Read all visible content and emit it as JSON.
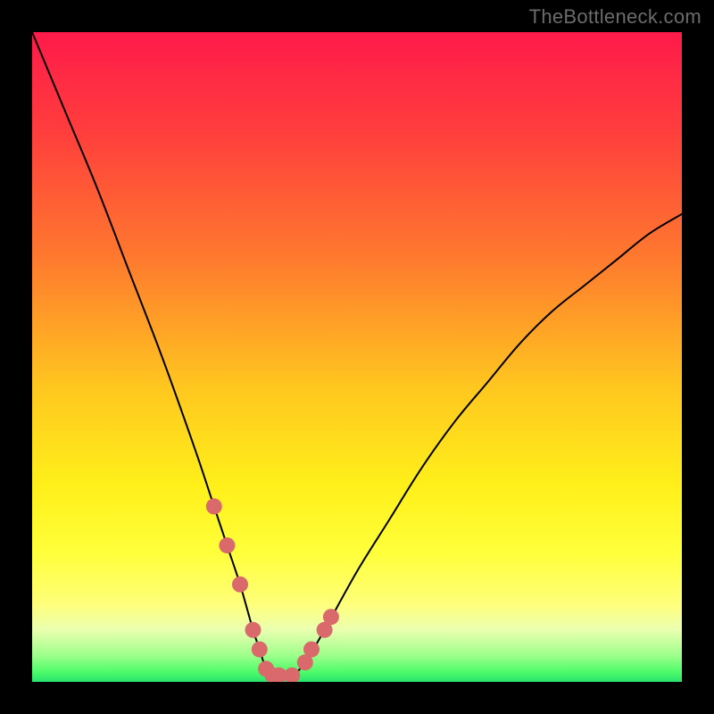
{
  "watermark": "TheBottleneck.com",
  "chart_data": {
    "type": "line",
    "title": "",
    "xlabel": "",
    "ylabel": "",
    "xlim": [
      0,
      100
    ],
    "ylim": [
      0,
      100
    ],
    "series": [
      {
        "name": "bottleneck-curve",
        "x": [
          0,
          5,
          10,
          15,
          20,
          25,
          28,
          30,
          32,
          34,
          35,
          36,
          37,
          38,
          40,
          42,
          45,
          50,
          55,
          60,
          65,
          70,
          75,
          80,
          85,
          90,
          95,
          100
        ],
        "values": [
          100,
          88,
          76,
          63,
          50,
          36,
          27,
          21,
          15,
          8,
          5,
          2,
          1,
          1,
          1,
          3,
          8,
          17,
          25,
          33,
          40,
          46,
          52,
          57,
          61,
          65,
          69,
          72
        ]
      }
    ],
    "markers": {
      "name": "highlight-dots",
      "color": "#d9696a",
      "x": [
        28,
        30,
        32,
        34,
        35,
        36,
        37,
        38,
        40,
        42,
        43,
        45,
        46
      ],
      "values": [
        27,
        21,
        15,
        8,
        5,
        2,
        1,
        1,
        1,
        3,
        5,
        8,
        10
      ]
    },
    "gradient_stops": [
      {
        "offset": 0.0,
        "color": "#ff1a4a"
      },
      {
        "offset": 0.15,
        "color": "#ff3d3d"
      },
      {
        "offset": 0.35,
        "color": "#ff7a2e"
      },
      {
        "offset": 0.55,
        "color": "#ffc81f"
      },
      {
        "offset": 0.7,
        "color": "#fff01a"
      },
      {
        "offset": 0.8,
        "color": "#ffff3a"
      },
      {
        "offset": 0.88,
        "color": "#ffff7a"
      },
      {
        "offset": 0.92,
        "color": "#eaffb0"
      },
      {
        "offset": 0.96,
        "color": "#9cff8a"
      },
      {
        "offset": 0.985,
        "color": "#4dfb6a"
      },
      {
        "offset": 1.0,
        "color": "#29e36e"
      }
    ]
  }
}
